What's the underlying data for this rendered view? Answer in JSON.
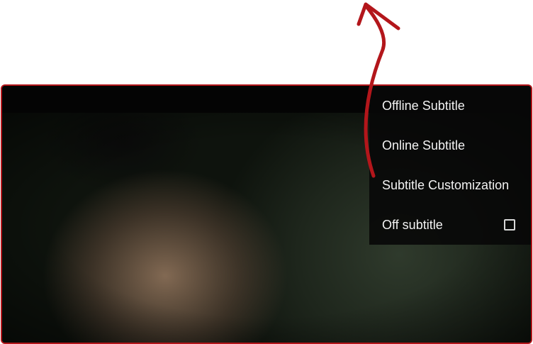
{
  "menu": {
    "items": [
      {
        "label": "Offline Subtitle"
      },
      {
        "label": "Online Subtitle"
      },
      {
        "label": "Subtitle Customization"
      },
      {
        "label": "Off subtitle",
        "checked": false
      }
    ]
  },
  "colors": {
    "annotation": "#b3161b",
    "menu_bg": "#080808",
    "menu_text": "#f2f2f2"
  },
  "icons": {
    "annotation_arrow": "arrow-up-icon",
    "toggle": "checkbox-icon"
  }
}
